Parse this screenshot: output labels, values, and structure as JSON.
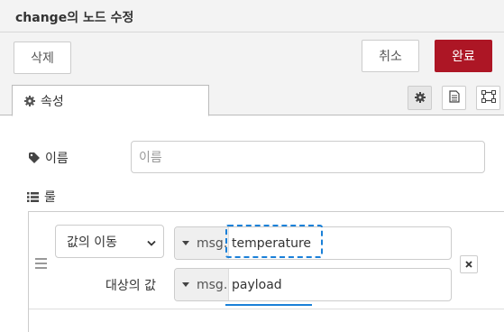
{
  "dialog": {
    "title": "change의 노드 수정"
  },
  "toolbar": {
    "delete_label": "삭제",
    "cancel_label": "취소",
    "done_label": "완료"
  },
  "tabs": {
    "properties_label": "속성",
    "properties_icon": "gear-icon",
    "side_buttons": [
      "gear-icon",
      "document-icon",
      "frame-icon"
    ]
  },
  "form": {
    "name_label": "이름",
    "name_placeholder": "이름",
    "rules_label": "룰"
  },
  "rule": {
    "action": "값의 이동",
    "source_prefix": "msg.",
    "source_value": "temperature",
    "target_label": "대상의 값",
    "target_prefix": "msg.",
    "target_value": "payload",
    "remove_icon": "close-icon"
  },
  "colors": {
    "accent": "#ad1625",
    "focus": "#1a80d8"
  }
}
